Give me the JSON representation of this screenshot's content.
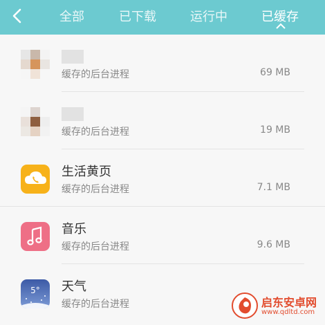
{
  "header": {
    "tabs": [
      {
        "label": "全部"
      },
      {
        "label": "已下载"
      },
      {
        "label": "运行中"
      },
      {
        "label": "已缓存"
      }
    ],
    "active_tab": "已缓存"
  },
  "apps": [
    {
      "name": "",
      "subtitle": "缓存的后台进程",
      "size": "69 MB",
      "icon": "blurred-app-icon"
    },
    {
      "name": "",
      "subtitle": "缓存的后台进程",
      "size": "19 MB",
      "icon": "blurred-app-icon"
    },
    {
      "name": "生活黄页",
      "subtitle": "缓存的后台进程",
      "size": "7.1 MB",
      "icon": "yellow-pages-icon"
    },
    {
      "name": "音乐",
      "subtitle": "缓存的后台进程",
      "size": "9.6 MB",
      "icon": "music-icon"
    },
    {
      "name": "天气",
      "subtitle": "缓存的后台进程",
      "size": "",
      "icon": "weather-icon",
      "icon_text": "5°"
    }
  ],
  "watermark": {
    "title": "启东安卓网",
    "url": "www.qdltd.com"
  },
  "colors": {
    "header": "#6ccad0",
    "yellow": "#f7b21a",
    "music": "#ee6f86",
    "weather": "#4f72b8"
  }
}
